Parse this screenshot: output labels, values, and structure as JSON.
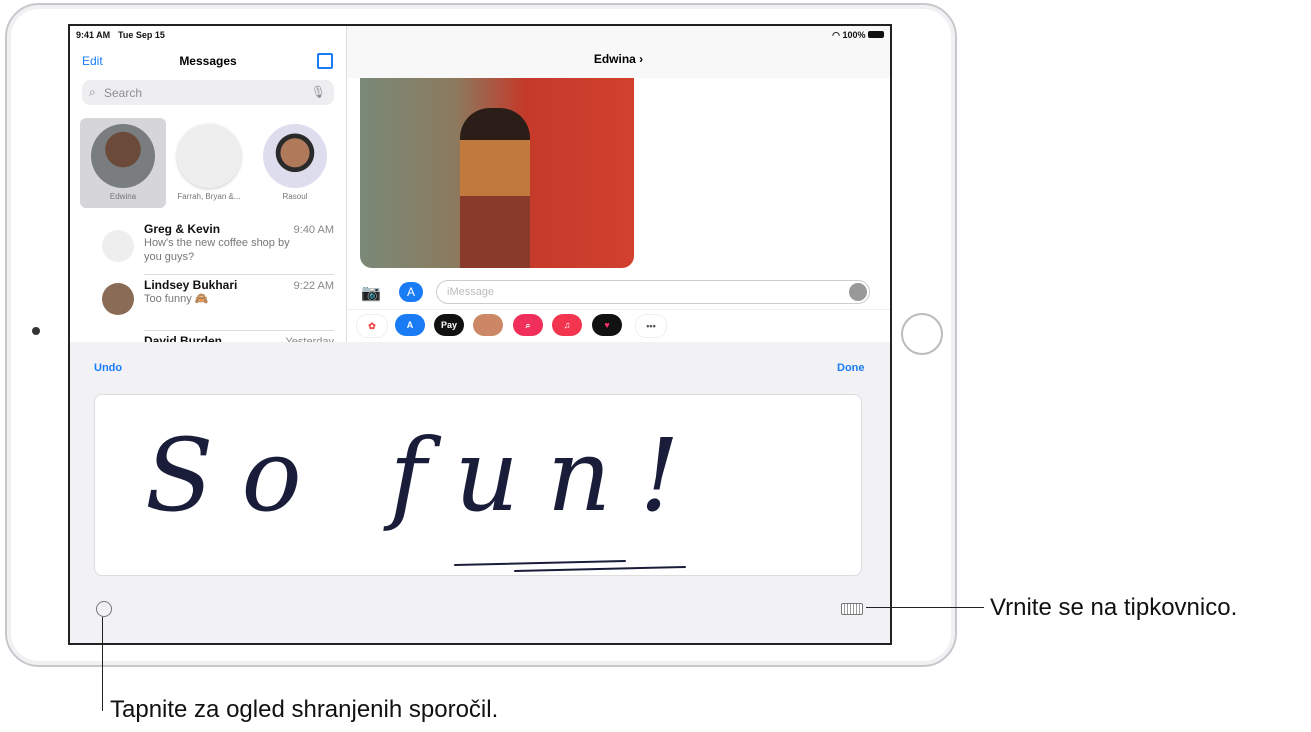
{
  "status": {
    "time": "9:41 AM",
    "date": "Tue Sep 15",
    "battery": "100%"
  },
  "sidebar": {
    "edit": "Edit",
    "title": "Messages",
    "search_placeholder": "Search",
    "pinned": [
      {
        "name": "Edwina"
      },
      {
        "name": "Farrah, Bryan &..."
      },
      {
        "name": "Rasoul"
      }
    ],
    "conversations": [
      {
        "name": "Greg & Kevin",
        "time": "9:40 AM",
        "preview": "How's the new coffee shop by you guys?"
      },
      {
        "name": "Lindsey Bukhari",
        "time": "9:22 AM",
        "preview": "Too funny 🙈"
      },
      {
        "name": "David Burden",
        "time": "Yesterday",
        "preview": ""
      }
    ]
  },
  "thread": {
    "contact": "Edwina",
    "input_placeholder": "iMessage",
    "apps": [
      "photos",
      "app-store",
      "Pay",
      "memoji",
      "search-images",
      "music",
      "digital-touch",
      "more"
    ]
  },
  "handwriting": {
    "undo": "Undo",
    "done": "Done",
    "text": "So fun!"
  },
  "callouts": {
    "keyboard": "Vrnite se na tipkovnico.",
    "history": "Tapnite za ogled shranjenih sporočil."
  },
  "colors": {
    "accent": "#1a7cf5",
    "keyboard_bg": "#f2f2f6"
  }
}
